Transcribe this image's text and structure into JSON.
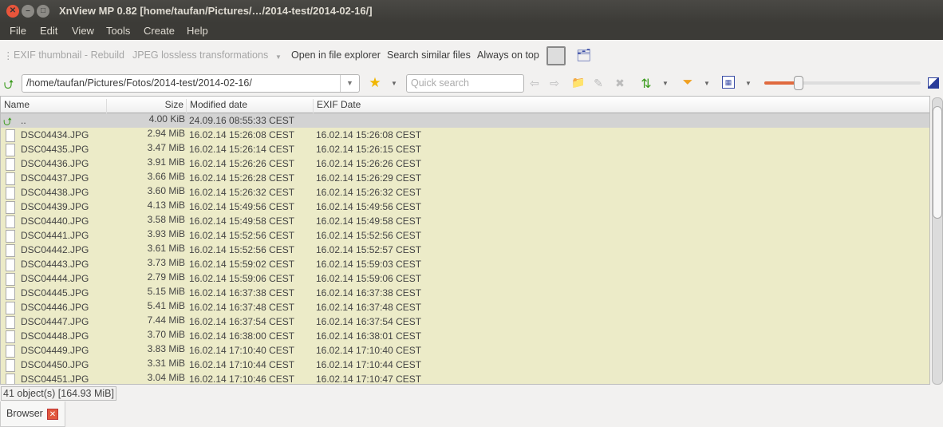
{
  "window": {
    "title": "XnView MP 0.82 [home/taufan/Pictures/…/2014-test/2014-02-16/]"
  },
  "menu": [
    "File",
    "Edit",
    "View",
    "Tools",
    "Create",
    "Help"
  ],
  "toolbar": {
    "exif_rebuild": "EXIF thumbnail - Rebuild",
    "jpeg_lossless": "JPEG lossless transformations",
    "open_explorer": "Open in file explorer",
    "search_similar": "Search similar files",
    "always_on_top": "Always on top"
  },
  "address": {
    "path": "/home/taufan/Pictures/Fotos/2014-test/2014-02-16/",
    "search_placeholder": "Quick search"
  },
  "thumb_size_percent": 22,
  "columns": [
    "Name",
    "Size",
    "Modified date",
    "EXIF Date"
  ],
  "parent_row": {
    "name": "..",
    "size": "4.00 KiB",
    "modified": "24.09.16 08:55:33 CEST",
    "exif": ""
  },
  "files": [
    {
      "name": "DSC04434.JPG",
      "size": "2.94 MiB",
      "modified": "16.02.14 15:26:08 CEST",
      "exif": "16.02.14 15:26:08 CEST"
    },
    {
      "name": "DSC04435.JPG",
      "size": "3.47 MiB",
      "modified": "16.02.14 15:26:14 CEST",
      "exif": "16.02.14 15:26:15 CEST"
    },
    {
      "name": "DSC04436.JPG",
      "size": "3.91 MiB",
      "modified": "16.02.14 15:26:26 CEST",
      "exif": "16.02.14 15:26:26 CEST"
    },
    {
      "name": "DSC04437.JPG",
      "size": "3.66 MiB",
      "modified": "16.02.14 15:26:28 CEST",
      "exif": "16.02.14 15:26:29 CEST"
    },
    {
      "name": "DSC04438.JPG",
      "size": "3.60 MiB",
      "modified": "16.02.14 15:26:32 CEST",
      "exif": "16.02.14 15:26:32 CEST"
    },
    {
      "name": "DSC04439.JPG",
      "size": "4.13 MiB",
      "modified": "16.02.14 15:49:56 CEST",
      "exif": "16.02.14 15:49:56 CEST"
    },
    {
      "name": "DSC04440.JPG",
      "size": "3.58 MiB",
      "modified": "16.02.14 15:49:58 CEST",
      "exif": "16.02.14 15:49:58 CEST"
    },
    {
      "name": "DSC04441.JPG",
      "size": "3.93 MiB",
      "modified": "16.02.14 15:52:56 CEST",
      "exif": "16.02.14 15:52:56 CEST"
    },
    {
      "name": "DSC04442.JPG",
      "size": "3.61 MiB",
      "modified": "16.02.14 15:52:56 CEST",
      "exif": "16.02.14 15:52:57 CEST"
    },
    {
      "name": "DSC04443.JPG",
      "size": "3.73 MiB",
      "modified": "16.02.14 15:59:02 CEST",
      "exif": "16.02.14 15:59:03 CEST"
    },
    {
      "name": "DSC04444.JPG",
      "size": "2.79 MiB",
      "modified": "16.02.14 15:59:06 CEST",
      "exif": "16.02.14 15:59:06 CEST"
    },
    {
      "name": "DSC04445.JPG",
      "size": "5.15 MiB",
      "modified": "16.02.14 16:37:38 CEST",
      "exif": "16.02.14 16:37:38 CEST"
    },
    {
      "name": "DSC04446.JPG",
      "size": "5.41 MiB",
      "modified": "16.02.14 16:37:48 CEST",
      "exif": "16.02.14 16:37:48 CEST"
    },
    {
      "name": "DSC04447.JPG",
      "size": "7.44 MiB",
      "modified": "16.02.14 16:37:54 CEST",
      "exif": "16.02.14 16:37:54 CEST"
    },
    {
      "name": "DSC04448.JPG",
      "size": "3.70 MiB",
      "modified": "16.02.14 16:38:00 CEST",
      "exif": "16.02.14 16:38:01 CEST"
    },
    {
      "name": "DSC04449.JPG",
      "size": "3.83 MiB",
      "modified": "16.02.14 17:10:40 CEST",
      "exif": "16.02.14 17:10:40 CEST"
    },
    {
      "name": "DSC04450.JPG",
      "size": "3.31 MiB",
      "modified": "16.02.14 17:10:44 CEST",
      "exif": "16.02.14 17:10:44 CEST"
    },
    {
      "name": "DSC04451.JPG",
      "size": "3.04 MiB",
      "modified": "16.02.14 17:10:46 CEST",
      "exif": "16.02.14 17:10:47 CEST"
    }
  ],
  "status": "41 object(s) [164.93 MiB]",
  "tabs": [
    {
      "label": "Browser"
    }
  ]
}
